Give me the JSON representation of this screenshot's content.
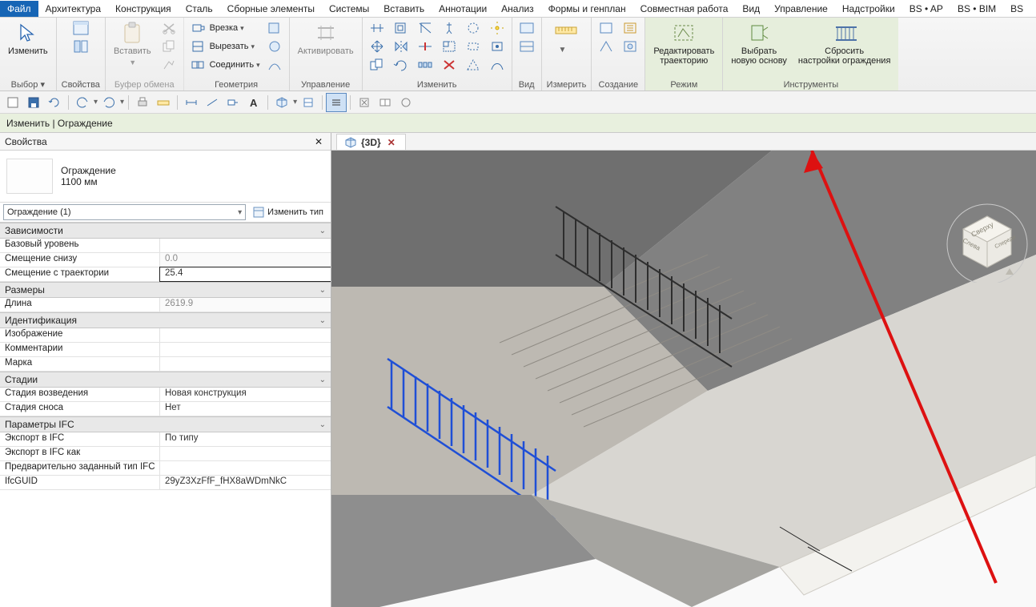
{
  "menu": {
    "items": [
      "Файл",
      "Архитектура",
      "Конструкция",
      "Сталь",
      "Сборные элементы",
      "Системы",
      "Вставить",
      "Аннотации",
      "Анализ",
      "Формы и генплан",
      "Совместная работа",
      "Вид",
      "Управление",
      "Надстройки",
      "BS • AP",
      "BS • BIM",
      "BS"
    ]
  },
  "ribbon": {
    "groups": [
      {
        "label": "Выбор",
        "drop": " ▾"
      },
      {
        "label": "Свойства"
      },
      {
        "label": "Буфер обмена"
      },
      {
        "label": "Геометрия"
      },
      {
        "label": "Управление"
      },
      {
        "label": "Изменить"
      },
      {
        "label": "Вид"
      },
      {
        "label": "Измерить"
      },
      {
        "label": "Создание"
      },
      {
        "label": "Режим"
      },
      {
        "label": "Инструменты"
      }
    ],
    "big": {
      "modify": "Изменить",
      "paste": "Вставить",
      "activate": "Активировать",
      "edit_path": "Редактировать\nтраекторию",
      "pick_host": "Выбрать\nновую основу",
      "reset": "Сбросить\nнастройки ограждения"
    },
    "small": {
      "cut": "Врезка",
      "clip": "Вырезать",
      "join": "Соединить"
    }
  },
  "optbar": {
    "text": "Изменить | Ограждение"
  },
  "properties": {
    "title": "Свойства",
    "type_name": "Ограждение",
    "type_size": "1100 мм",
    "selector": "Ограждение (1)",
    "edit_type": "Изменить тип",
    "groups": {
      "deps": "Зависимости",
      "dims": "Размеры",
      "ident": "Идентификация",
      "phases": "Стадии",
      "ifc": "Параметры IFC"
    },
    "rows": {
      "base_level": "Базовый уровень",
      "base_level_v": "",
      "offset_bottom": "Смещение снизу",
      "offset_bottom_v": "0.0",
      "offset_path": "Смещение с траектории",
      "offset_path_v": "25.4",
      "length": "Длина",
      "length_v": "2619.9",
      "image": "Изображение",
      "comments": "Комментарии",
      "mark": "Марка",
      "phase_created": "Стадия возведения",
      "phase_created_v": "Новая конструкция",
      "phase_demo": "Стадия сноса",
      "phase_demo_v": "Нет",
      "export_ifc": "Экспорт в IFC",
      "export_ifc_v": "По типу",
      "export_ifc_as": "Экспорт в IFC как",
      "predef_ifc": "Предварительно заданный тип IFC",
      "ifcguid": "IfcGUID",
      "ifcguid_v": "29yZ3XzFfF_fHX8aWDmNkC"
    }
  },
  "view": {
    "tab_label": "{3D}"
  },
  "navcube": {
    "top": "Сверху",
    "left": "Слева",
    "front": "Спереди"
  }
}
